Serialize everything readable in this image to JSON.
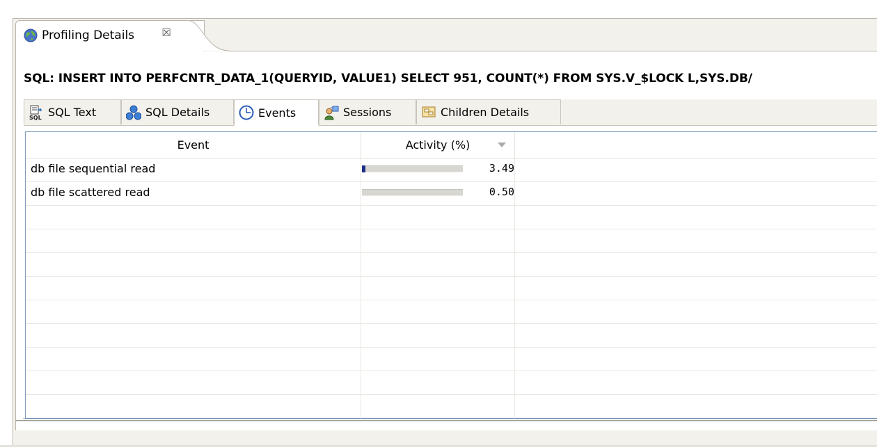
{
  "view": {
    "tab_title": "Profiling Details",
    "tab_icon": "globe-icon",
    "close_icon": "close-icon",
    "close_glyph": "☒"
  },
  "sql_title": "SQL: INSERT INTO PERFCNTR_DATA_1(QUERYID, VALUE1) SELECT 951, COUNT(*) FROM SYS.V_$LOCK L,SYS.DB/",
  "subtabs": [
    {
      "label": "SQL Text",
      "icon": "sql-text-icon",
      "active": false
    },
    {
      "label": "SQL Details",
      "icon": "sql-details-icon",
      "active": false
    },
    {
      "label": "Events",
      "icon": "clock-icon",
      "active": true
    },
    {
      "label": "Sessions",
      "icon": "sessions-icon",
      "active": false
    },
    {
      "label": "Children Details",
      "icon": "children-details-icon",
      "active": false
    }
  ],
  "table": {
    "columns": [
      "Event",
      "Activity (%)"
    ],
    "rows": [
      {
        "event": "db file sequential read",
        "activity": "3.49",
        "activity_fraction": 0.0349
      },
      {
        "event": "db file scattered read",
        "activity": "0.50",
        "activity_fraction": 0.005
      }
    ]
  },
  "colors": {
    "bar_fill": "#1e2f8a",
    "bar_track": "#d8d6d0",
    "frame_bg": "#f3f1ec"
  }
}
